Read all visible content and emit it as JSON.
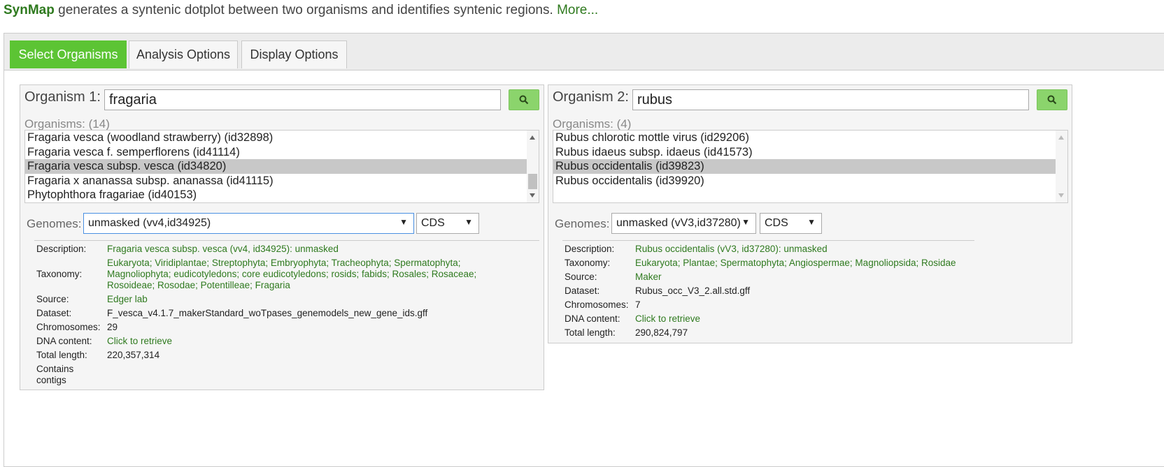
{
  "header": {
    "brand": "SynMap",
    "description": " generates a syntenic dotplot between two organisms and identifies syntenic regions. ",
    "more_link": "More..."
  },
  "tabs": [
    {
      "label": "Select Organisms",
      "active": true
    },
    {
      "label": "Analysis Options",
      "active": false
    },
    {
      "label": "Display Options",
      "active": false
    }
  ],
  "org1": {
    "label": "Organism 1:",
    "search_value": "fragaria",
    "organisms_label": "Organisms: (14)",
    "list": [
      "Fragaria vesca (woodland strawberry) (id32898)",
      "Fragaria vesca f. semperflorens (id41114)",
      "Fragaria vesca subsp. vesca (id34820)",
      "Fragaria x ananassa subsp. ananassa (id41115)",
      "Phytophthora fragariae (id40153)"
    ],
    "selected_index": 2,
    "genomes_label": "Genomes:",
    "genome_selected": "unmasked (vv4,id34925)",
    "feature_selected": "CDS",
    "info": {
      "description_label": "Description:",
      "description_value": "Fragaria vesca subsp. vesca (vv4, id34925): unmasked",
      "taxonomy_label": "Taxonomy:",
      "taxonomy_line1": "Eukaryota; Viridiplantae; Streptophyta; Embryophyta; Tracheophyta; Spermatophyta;",
      "taxonomy_line2": "Magnoliophyta; eudicotyledons; core eudicotyledons; rosids; fabids; Rosales; Rosaceae;",
      "taxonomy_line3": "Rosoideae; Rosodae; Potentilleae; Fragaria",
      "source_label": "Source:",
      "source_value": "Edger lab",
      "dataset_label": "Dataset:",
      "dataset_value": "F_vesca_v4.1.7_makerStandard_woTpases_genemodels_new_gene_ids.gff",
      "chromosomes_label": "Chromosomes:",
      "chromosomes_value": "29",
      "dna_label": "DNA content:",
      "dna_value": "Click to retrieve",
      "length_label": "Total length:",
      "length_value": "220,357,314",
      "contigs_line1": "Contains",
      "contigs_line2": "contigs"
    }
  },
  "org2": {
    "label": "Organism 2:",
    "search_value": "rubus",
    "organisms_label": "Organisms: (4)",
    "list": [
      "Rubus chlorotic mottle virus (id29206)",
      "Rubus idaeus subsp. idaeus (id41573)",
      "Rubus occidentalis (id39823)",
      "Rubus occidentalis (id39920)"
    ],
    "selected_index": 2,
    "genomes_label": "Genomes:",
    "genome_selected": "unmasked (vV3,id37280)",
    "feature_selected": "CDS",
    "info": {
      "description_label": "Description:",
      "description_value": "Rubus occidentalis (vV3, id37280): unmasked",
      "taxonomy_label": "Taxonomy:",
      "taxonomy_value": "Eukaryota; Plantae; Spermatophyta; Angiospermae; Magnoliopsida; Rosidae",
      "source_label": "Source:",
      "source_value": "Maker",
      "dataset_label": "Dataset:",
      "dataset_value": "Rubus_occ_V3_2.all.std.gff",
      "chromosomes_label": "Chromosomes:",
      "chromosomes_value": "7",
      "dna_label": "DNA content:",
      "dna_value": "Click to retrieve",
      "length_label": "Total length:",
      "length_value": "290,824,797"
    }
  }
}
